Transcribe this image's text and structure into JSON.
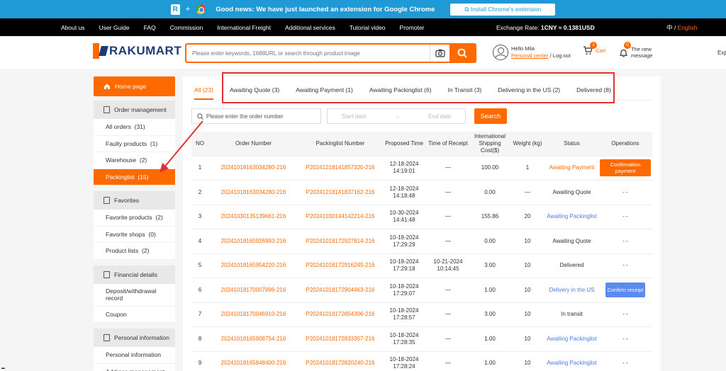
{
  "promo": {
    "news": "Good news: We have just launched an extension for Google Chrome",
    "install": "Install Chrome's extension"
  },
  "topnav": {
    "links": [
      "About us",
      "User Guide",
      "FAQ",
      "Commission",
      "International Freight",
      "Additional services",
      "Tutorial video",
      "Promoter"
    ],
    "rate_label": "Exchange Rate: ",
    "rate_value": "1CNY ≈ 0.1381USD",
    "lang_cn": "中",
    "lang_sep": " / ",
    "lang_en": "English"
  },
  "header": {
    "brand_a": "RAKU",
    "brand_b": "MART",
    "search_placeholder": "Please enter keywords, 1688URL or search through product image",
    "hello": "Hello Mila",
    "personal_center": "Personal center",
    "logout": " / Log out",
    "cart_label": "Cart",
    "cart_count": "1",
    "msg_count": "0",
    "msg_line1": "The new",
    "msg_line2": "message",
    "exp": "Exp"
  },
  "sidebar": {
    "home": "Home page",
    "sections": [
      {
        "title": "Order management",
        "items": [
          "All orders  (31)",
          "Faulty products  (1)",
          "Warehouse  (2)",
          "Packinglist  (15)"
        ]
      },
      {
        "title": "Favorites",
        "items": [
          "Favorite products  (2)",
          "Favorite shops  (0)",
          "Product lists  (2)"
        ]
      },
      {
        "title": "Financial details",
        "items": [
          "Deposit/withdrawal record",
          "Coupon"
        ]
      },
      {
        "title": "Personal information",
        "items": [
          "Personal information",
          "Address management"
        ]
      }
    ]
  },
  "tabs": [
    "All (23)",
    "Awaiting Quote (3)",
    "Awaiting Payment (1)",
    "Awaiting Packinglist (6)",
    "In Transit (3)",
    "Delivering in the US (2)",
    "Delivered (8)"
  ],
  "filter": {
    "order_placeholder": "Please enter the order number",
    "start": "Start date",
    "arrow": "→",
    "end": "End date",
    "search": "Search"
  },
  "table": {
    "headers": [
      "NO",
      "Order Number",
      "Packinglist Number",
      "Proposed Time",
      "Time of Receipt",
      "International Shipping Cost($)",
      "Weight (kg)",
      "Status",
      "Operations"
    ],
    "rows": [
      {
        "no": "1",
        "order": "202410181630342​80-216",
        "pack": "P202412181418573​20-216",
        "proposed": "12-18-2024 14:19:01",
        "receipt": "—",
        "cost": "100.00",
        "weight": "1",
        "status": "Awaiting Payment",
        "status_color": "orange",
        "op": "Confirmation payment",
        "op_type": "orange"
      },
      {
        "no": "2",
        "order": "20241018163034280-216",
        "pack": "P20241218141837162-216",
        "proposed": "12-18-2024 14:18:48",
        "receipt": "—",
        "cost": "0.00",
        "weight": "—",
        "status": "Awaiting Quote",
        "status_color": "normal",
        "op": "- -",
        "op_type": "text"
      },
      {
        "no": "3",
        "order": "20241030135139661-216",
        "pack": "P20241030144142214-216",
        "proposed": "10-30-2024 14:41:48",
        "receipt": "—",
        "cost": "155.86",
        "weight": "20",
        "status": "Awaiting Packinglist",
        "status_color": "blue",
        "op": "- -",
        "op_type": "text"
      },
      {
        "no": "4",
        "order": "20241018165926993-216",
        "pack": "P20241018172927814-216",
        "proposed": "10-18-2024 17:29:29",
        "receipt": "—",
        "cost": "0.00",
        "weight": "10",
        "status": "Awaiting Quote",
        "status_color": "normal",
        "op": "- -",
        "op_type": "text"
      },
      {
        "no": "5",
        "order": "20241018165954220-216",
        "pack": "P20241018172916245-216",
        "proposed": "10-18-2024 17:29:18",
        "receipt": "10-21-2024 10:14:45",
        "cost": "3.00",
        "weight": "10",
        "status": "Delivered",
        "status_color": "normal",
        "op": "- -",
        "op_type": "text"
      },
      {
        "no": "6",
        "order": "20241018170007896-216",
        "pack": "P20241018172904463-216",
        "proposed": "10-18-2024 17:29:07",
        "receipt": "—",
        "cost": "1.00",
        "weight": "10",
        "status": "Delivery in the US",
        "status_color": "blue",
        "op": "Confirm receipt",
        "op_type": "blue"
      },
      {
        "no": "7",
        "order": "20241018170046910-216",
        "pack": "P20241018172854306-216",
        "proposed": "10-18-2024 17:28:57",
        "receipt": "—",
        "cost": "3.00",
        "weight": "10",
        "status": "In transit",
        "status_color": "normal",
        "op": "- -",
        "op_type": "text"
      },
      {
        "no": "8",
        "order": "20241018165908754-216",
        "pack": "P20241018172833357-216",
        "proposed": "10-18-2024 17:28:35",
        "receipt": "—",
        "cost": "1.00",
        "weight": "10",
        "status": "Awaiting Packinglist",
        "status_color": "blue",
        "op": "- -",
        "op_type": "text"
      },
      {
        "no": "9",
        "order": "20241018165848400-216",
        "pack": "P20241018172820240-216",
        "proposed": "10-18-2024 17:28:24",
        "receipt": "—",
        "cost": "1.00",
        "weight": "10",
        "status": "Awaiting Packinglist",
        "status_color": "blue",
        "op": "- -",
        "op_type": "text"
      }
    ]
  },
  "colors": {
    "accent": "#ff6a00",
    "promo": "#1f9ad6",
    "link_blue": "#4a7ee8",
    "annotation": "#e53030"
  }
}
